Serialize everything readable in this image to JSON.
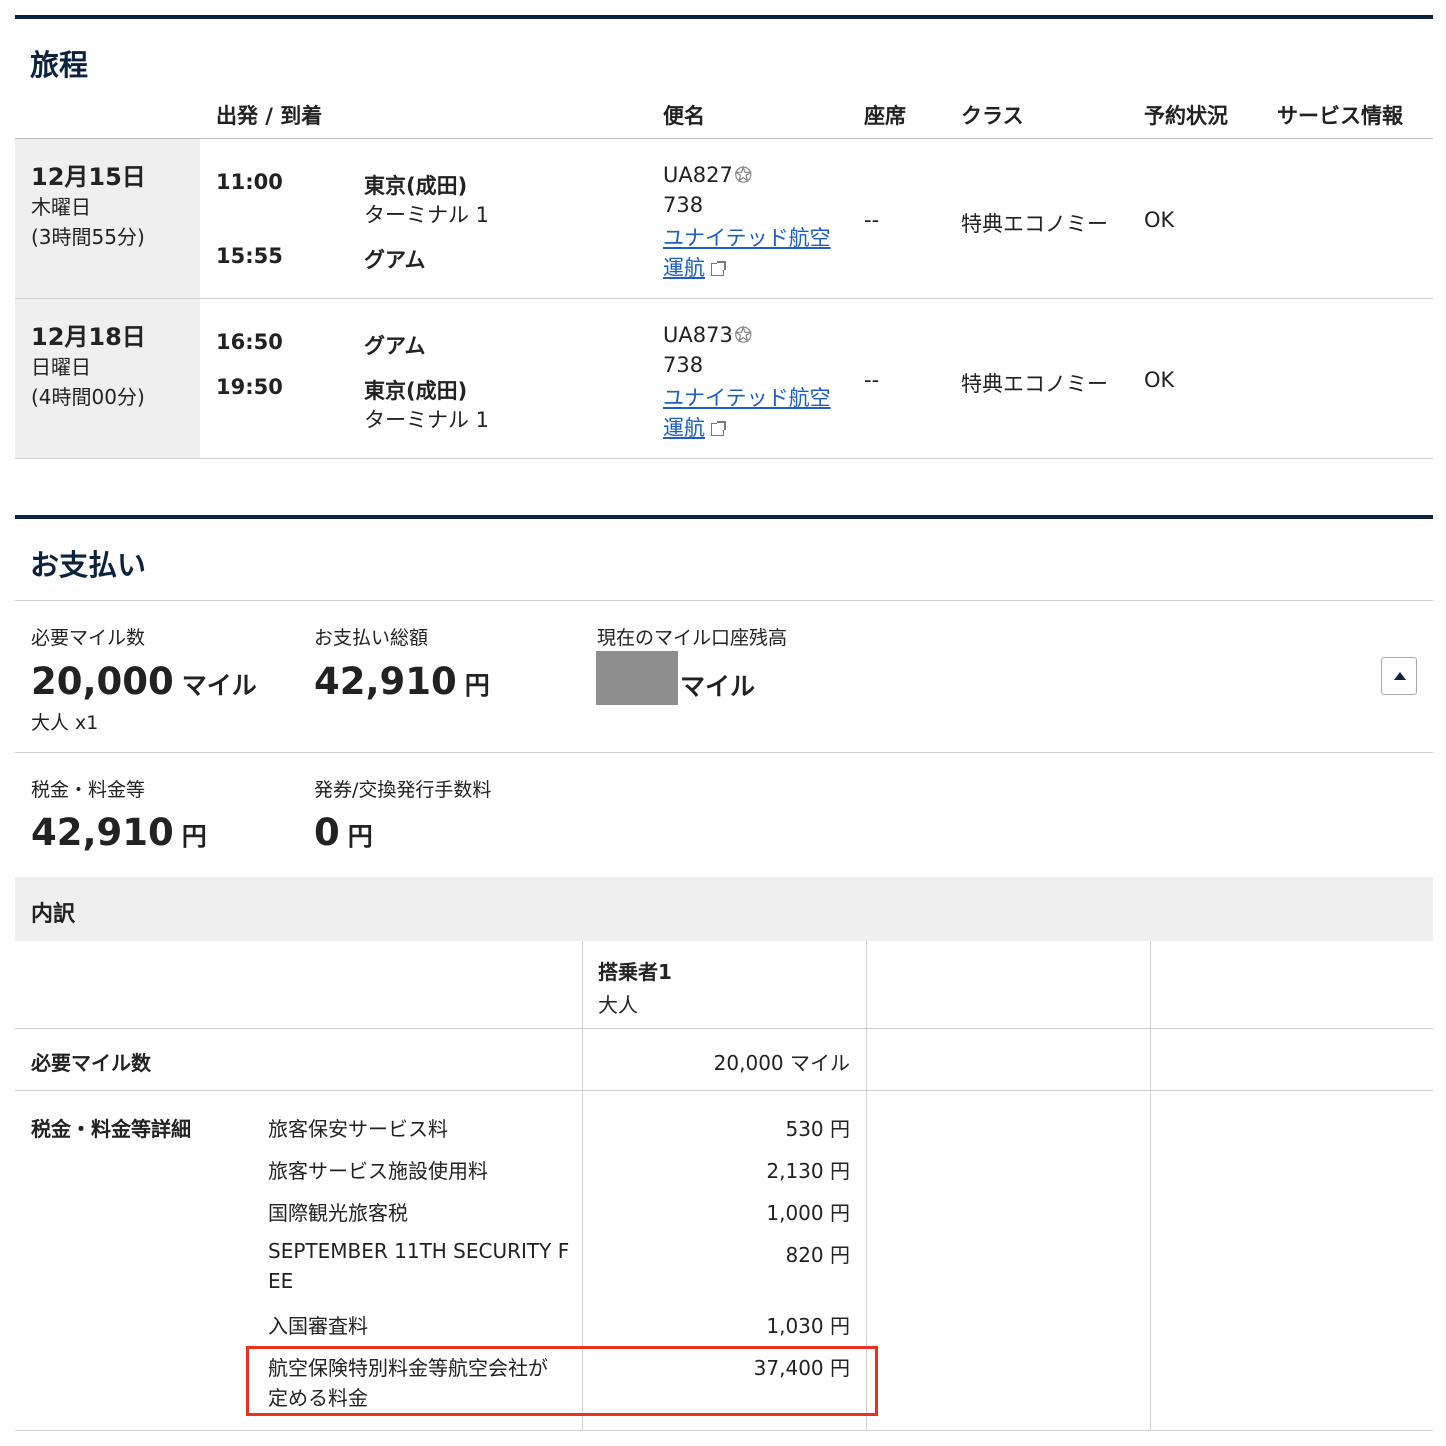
{
  "itinerary": {
    "title": "旅程",
    "headers": {
      "dep_arr": "出発 / 到着",
      "flight": "便名",
      "seat": "座席",
      "class": "クラス",
      "status": "予約状況",
      "service": "サービス情報"
    },
    "flights": [
      {
        "date": "12月15日",
        "weekday": "木曜日",
        "duration": "(3時間55分)",
        "dep_time": "11:00",
        "dep_city": "東京(成田)",
        "dep_terminal": "ターミナル 1",
        "arr_time": "15:55",
        "arr_city": "グアム",
        "arr_terminal": "",
        "flight_no": "UA827",
        "aircraft": "738",
        "operator_link_line1": "ユナイテッド航空",
        "operator_link_line2": "運航",
        "seat": "--",
        "cabin": "特典エコノミー",
        "status": "OK"
      },
      {
        "date": "12月18日",
        "weekday": "日曜日",
        "duration": "(4時間00分)",
        "dep_time": "16:50",
        "dep_city": "グアム",
        "dep_terminal": "",
        "arr_time": "19:50",
        "arr_city": "東京(成田)",
        "arr_terminal": "ターミナル 1",
        "flight_no": "UA873",
        "aircraft": "738",
        "operator_link_line1": "ユナイテッド航空",
        "operator_link_line2": "運航",
        "seat": "--",
        "cabin": "特典エコノミー",
        "status": "OK"
      }
    ]
  },
  "payment": {
    "title": "お支払い",
    "required_miles_label": "必要マイル数",
    "required_miles_value": "20,000",
    "required_miles_unit": "マイル",
    "passengers": "大人 x1",
    "total_label": "お支払い総額",
    "total_value": "42,910",
    "total_unit": "円",
    "balance_label": "現在のマイル口座残高",
    "balance_unit": "マイル",
    "taxes_label": "税金・料金等",
    "taxes_value": "42,910",
    "taxes_unit": "円",
    "ticketing_fee_label": "発券/交換発行手数料",
    "ticketing_fee_value": "0",
    "ticketing_fee_unit": "円"
  },
  "breakdown": {
    "title": "内訳",
    "passenger_header": "搭乗者1",
    "passenger_type": "大人",
    "miles_row_label": "必要マイル数",
    "miles_row_value": "20,000 マイル",
    "taxes_detail_label": "税金・料金等詳細",
    "items": [
      {
        "name": "旅客保安サービス料",
        "amount": "530 円"
      },
      {
        "name": "旅客サービス施設使用料",
        "amount": "2,130 円"
      },
      {
        "name": "国際観光旅客税",
        "amount": "1,000 円"
      },
      {
        "name_line1": "SEPTEMBER 11TH SECURITY F",
        "name_line2": "EE",
        "amount": "820 円"
      },
      {
        "name": "入国審査料",
        "amount": "1,030 円"
      },
      {
        "name_line1": "航空保険特別料金等航空会社が",
        "name_line2": "定める料金",
        "amount": "37,400 円"
      }
    ]
  },
  "colors": {
    "navy": "#0c2340",
    "link": "#1a5fc4",
    "highlight": "#e8321e",
    "gray_bg": "#efefef"
  }
}
